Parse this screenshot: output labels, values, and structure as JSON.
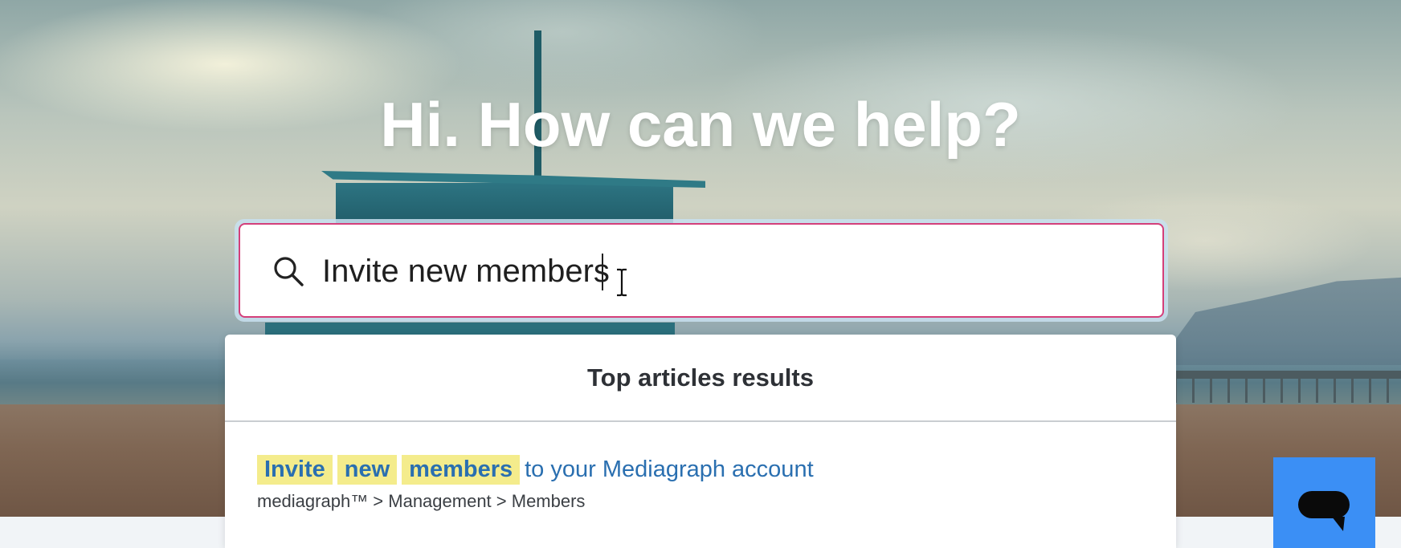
{
  "hero": {
    "headline": "Hi. How can we help?",
    "background": "beach-lifeguard-tower-photo"
  },
  "search": {
    "value": "Invite new members",
    "icon": "search-icon",
    "border_color": "#d43f7a"
  },
  "results": {
    "heading": "Top articles results",
    "items": [
      {
        "highlighted_terms": [
          "Invite",
          "new",
          "members"
        ],
        "title_rest": "to your Mediagraph account",
        "path": "mediagraph™ > Management > Members"
      }
    ]
  },
  "chat_widget": {
    "icon": "chat-bubble-icon",
    "color": "#3b8ff5"
  },
  "colors": {
    "highlight": "#f4ec8c",
    "link": "#2a6fb0"
  }
}
